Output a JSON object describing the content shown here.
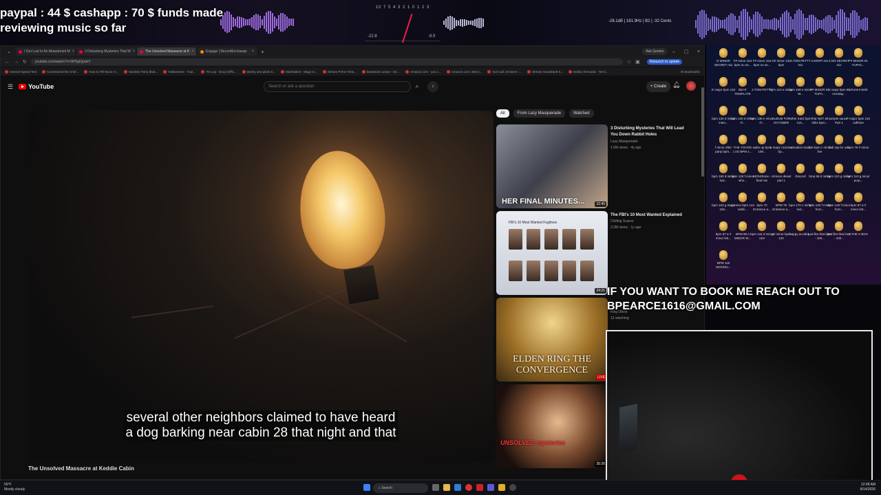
{
  "overlay": {
    "donation_line1": "paypal : 44 $  cashapp : 70 $ funds made",
    "donation_line2": "reviewing music so far",
    "meter_scale": "10 7 5 4 3 2 1 0 1 2 3",
    "meter_left": "-22.8",
    "meter_right": "-9.9",
    "analyzer_text": "-28.1dB | 181.9Hz | B2 | -32 Cents",
    "booking_line1": "IF YOU WANT TO BOOK ME REACH OUT TO",
    "booking_line2": "BPEARCE1616@GMAIL.COM"
  },
  "browser": {
    "tabs": [
      {
        "label": "I Got Lost In An Abandoned M",
        "active": false
      },
      {
        "label": "3 Disturbing Mysteries That W",
        "active": false
      },
      {
        "label": "The Unsolved Massacre at K",
        "active": true
      },
      {
        "label": "Engage | RecordExchange",
        "active": false
      }
    ],
    "new_tab": "+",
    "ask_gemini": "Ask Gemini",
    "url": "youtube.com/watch?v=3tF5gIQpdoY",
    "relaunch": "Relaunch to update",
    "bookmarks": [
      "Internet Speed Test",
      "Constrained the Chef...",
      "How to Tell Music V...",
      "Slumber Party (feat...",
      "Halloweene - Yout...",
      "Yin Lay - Drop (Offic...",
      "twenty one pilots S...",
      "Mambakes - Mags O...",
      "Stream Prime Time...",
      "beatstack Lamps - SC...",
      "Amazon.com - you c...",
      "Amazon.com: 338 G...",
      "Kid Cudi, Eminem -...",
      "Stream HoodStar$ S...",
      "Bobby Shmurda - Yes's..."
    ],
    "all_bookmarks": "All Bookmarks"
  },
  "youtube": {
    "logo": "YouTube",
    "search_placeholder": "Search or ask a question",
    "create": "Create",
    "caption_line1": "several other neighbors claimed to have heard",
    "caption_line2": "a dog barking near cabin 28 that night and that",
    "video_title": "The Unsolved Massacre at Keddie Cabin",
    "chips": [
      "All",
      "From Lazy Masquerade",
      "Watched"
    ],
    "recommendations": [
      {
        "title": "3 Disturbing Mysteries That Will Lead You Down Rabbit Holes",
        "channel": "Lazy Masquerade",
        "meta": "1.6M views · 4y ago",
        "duration": "22:40",
        "overlay": "HER FINAL MINUTES..."
      },
      {
        "title": "The FBI's 10 Most Wanted Explained",
        "channel": "Chilling Scares",
        "meta": "3.2M views · 1y ago",
        "duration": "24:21",
        "overlay": "FBI's 10 Most Wanted Fugitives"
      },
      {
        "title": "",
        "channel": "King Obvio",
        "meta": "12 watching",
        "duration": "LIVE",
        "overlay": "ELDEN RING THE CONVERGENCE"
      },
      {
        "title": "",
        "channel": "",
        "meta": "",
        "duration": "35:26",
        "overlay": "UNSOLVED mysteries"
      }
    ]
  },
  "desktop_icons": [
    "D MINOR SECRET mix",
    "F# minor 154 bpm no se...",
    "F# minor 154 bpm no se...",
    "G# minor 134 bpm",
    "3.TOM PETTY mix",
    "2.MGRT mix",
    "3.NO SECRET mix",
    "F# MINOR 81 TUPAC...",
    "E major bpm 118",
    "BEAT TEMPLATE",
    "3.TOM PETTY",
    "bpm 110 e minor",
    "bpm 108 e minor W...",
    "F# MINOR 81 TUPA...",
    "B major bpm 85 monday...",
    "uTorrent Web",
    "bpm 130 d minor inten...",
    "bpm 130 d minor IT...",
    "bpm 138 e minor IT...",
    "ALBUM FOR OCTOBER",
    "other track bpm 115...",
    "that NOT all folks bpm...",
    "sample sauce - Part 1",
    "F major bpm 115 caffeine",
    "f minor after party bpm...",
    "THE YOUNG LAD BPM 1...",
    "wake up bpm 108...",
    "a major rockstar bp...",
    "visualize track",
    "136 bpm c minor live",
    "fadi rap for use",
    "bpm 75 # minor",
    "bpm 150 d minor lust...",
    "bpm 128 f minor who...",
    "MONOtone - final mix",
    "crimson diesel part 1",
    "Discord",
    "bmp 86 b minor",
    "bpm 110 g minor",
    "bpm 110 g minor purp...",
    "bpm 153 g minor 156...",
    "g minor bpm 144 saltin...",
    "bpm 70 Entrance a...",
    "BPM 78 Entrance a...",
    "bpm 170 c minor lust...",
    "bpm 140 f minor from...",
    "bpm 140 f minor from...",
    "bpm 87 a # minor lett...",
    "bpm 87 a # minor lett...",
    "BPM 98 A MINOR W...",
    "bpm 144 d minor rant",
    "g# minor bpm 120",
    "happy accider...",
    "just like that intro - 100...",
    "just like that intro - 100...",
    "4.THE X-BOX",
    "BPM 118 MONOto..."
  ],
  "taskbar": {
    "weather_temp": "59°F",
    "weather_desc": "Mostly cloudy",
    "search": "Search",
    "time": "12:08 AM",
    "date": "8/14/2026"
  }
}
